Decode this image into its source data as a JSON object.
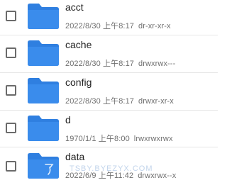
{
  "colors": {
    "folder_body": "#2f7fe0",
    "folder_tab": "#2f7fe0",
    "checkbox_border": "#6b6b6b",
    "divider": "#e6e6e6"
  },
  "files": [
    {
      "name": "acct",
      "date": "2022/8/30 上午8:17",
      "permissions": "dr-xr-xr-x",
      "icon": "folder-icon",
      "checked": false
    },
    {
      "name": "cache",
      "date": "2022/8/30 上午8:17",
      "permissions": "drwxrwx---",
      "icon": "folder-icon",
      "checked": false
    },
    {
      "name": "config",
      "date": "2022/8/30 上午8:17",
      "permissions": "drwxr-xr-x",
      "icon": "folder-icon",
      "checked": false
    },
    {
      "name": "d",
      "date": "1970/1/1 上午8:00",
      "permissions": "lrwxrwxrwx",
      "icon": "folder-link-icon",
      "checked": false
    },
    {
      "name": "data",
      "date": "2022/6/9 上午11:42",
      "permissions": "drwxrwx--x",
      "icon": "folder-icon",
      "checked": false
    }
  ],
  "watermark": "TSBY.BYEZYX.COM"
}
